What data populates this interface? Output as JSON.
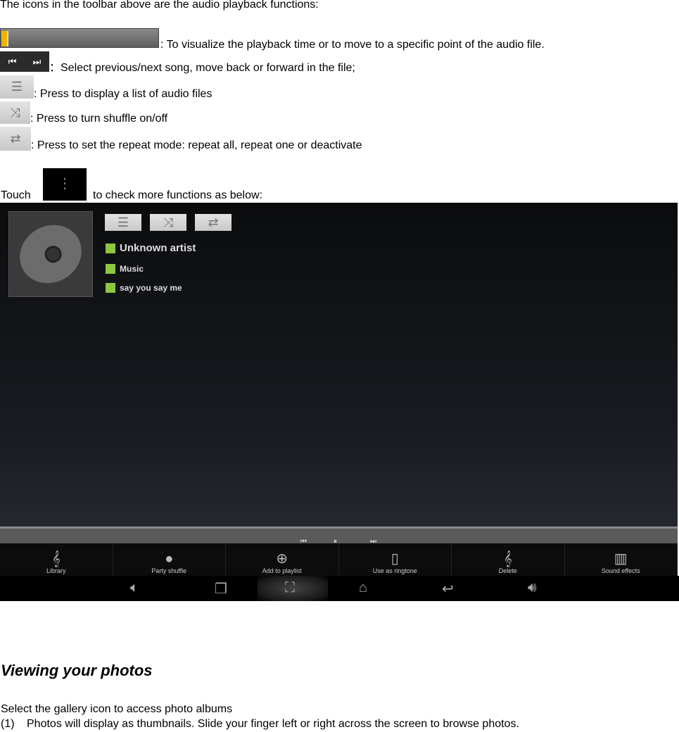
{
  "intro": "The icons in the toolbar above are the audio playback functions:",
  "items": [
    {
      "icon": "seek-bar",
      "text": ": To visualize the playback time or to move to a specific point of the audio file."
    },
    {
      "icon": "prev-next-icon",
      "text": "：Select previous/next song, move back or forward in the file;"
    },
    {
      "icon": "list-icon",
      "text": ": Press to display a list of audio files"
    },
    {
      "icon": "shuffle-icon",
      "text": ": Press to turn shuffle on/off"
    },
    {
      "icon": "repeat-icon",
      "text": ": Press to set the repeat mode: repeat all, repeat one or deactivate"
    }
  ],
  "touch_before": "Touch",
  "touch_after": "to check more functions as below:",
  "player": {
    "artist": "Unknown artist",
    "album": "Music",
    "song": "say you say me",
    "progress": 0.01,
    "menu": [
      "Library",
      "Party shuffle",
      "Add to playlist",
      "Use as ringtone",
      "Delete",
      "Sound effects"
    ]
  },
  "heading": "Viewing your photos",
  "para1": "Select the gallery icon to access photo albums",
  "para2_num": "(1)",
  "para2": "Photos will display as thumbnails. Slide your finger left or right across the screen to browse photos."
}
